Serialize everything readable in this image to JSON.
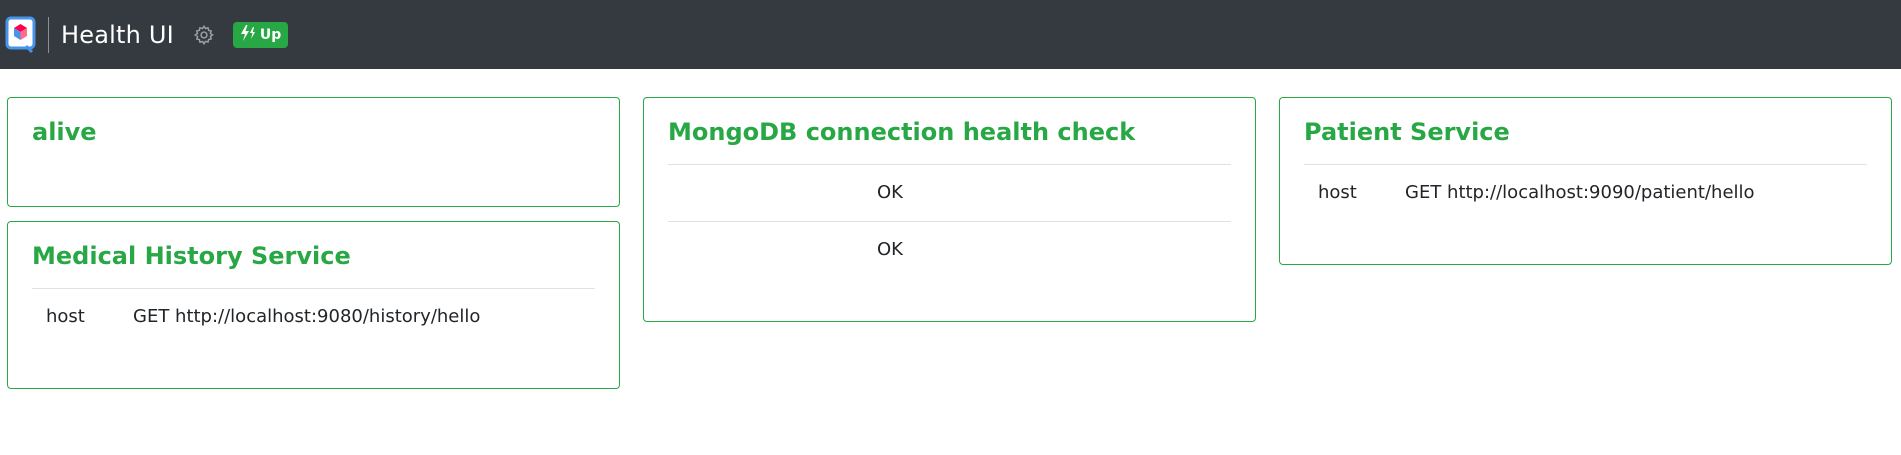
{
  "header": {
    "title": "Health UI",
    "status_label": "Up",
    "logo_icon": "quarkus-logo-icon",
    "settings_icon": "gear-icon",
    "status_icon": "bolt-icon",
    "status_color": "#28a745",
    "background": "#343a40"
  },
  "cards": {
    "alive": {
      "title": "alive"
    },
    "medical": {
      "title": "Medical History Service",
      "key": "host",
      "value": "GET http://localhost:9080/history/hello"
    },
    "mongo": {
      "title": "MongoDB connection health check",
      "row1": "OK",
      "row2": "OK"
    },
    "patient": {
      "title": "Patient Service",
      "key": "host",
      "value": "GET http://localhost:9090/patient/hello"
    }
  }
}
